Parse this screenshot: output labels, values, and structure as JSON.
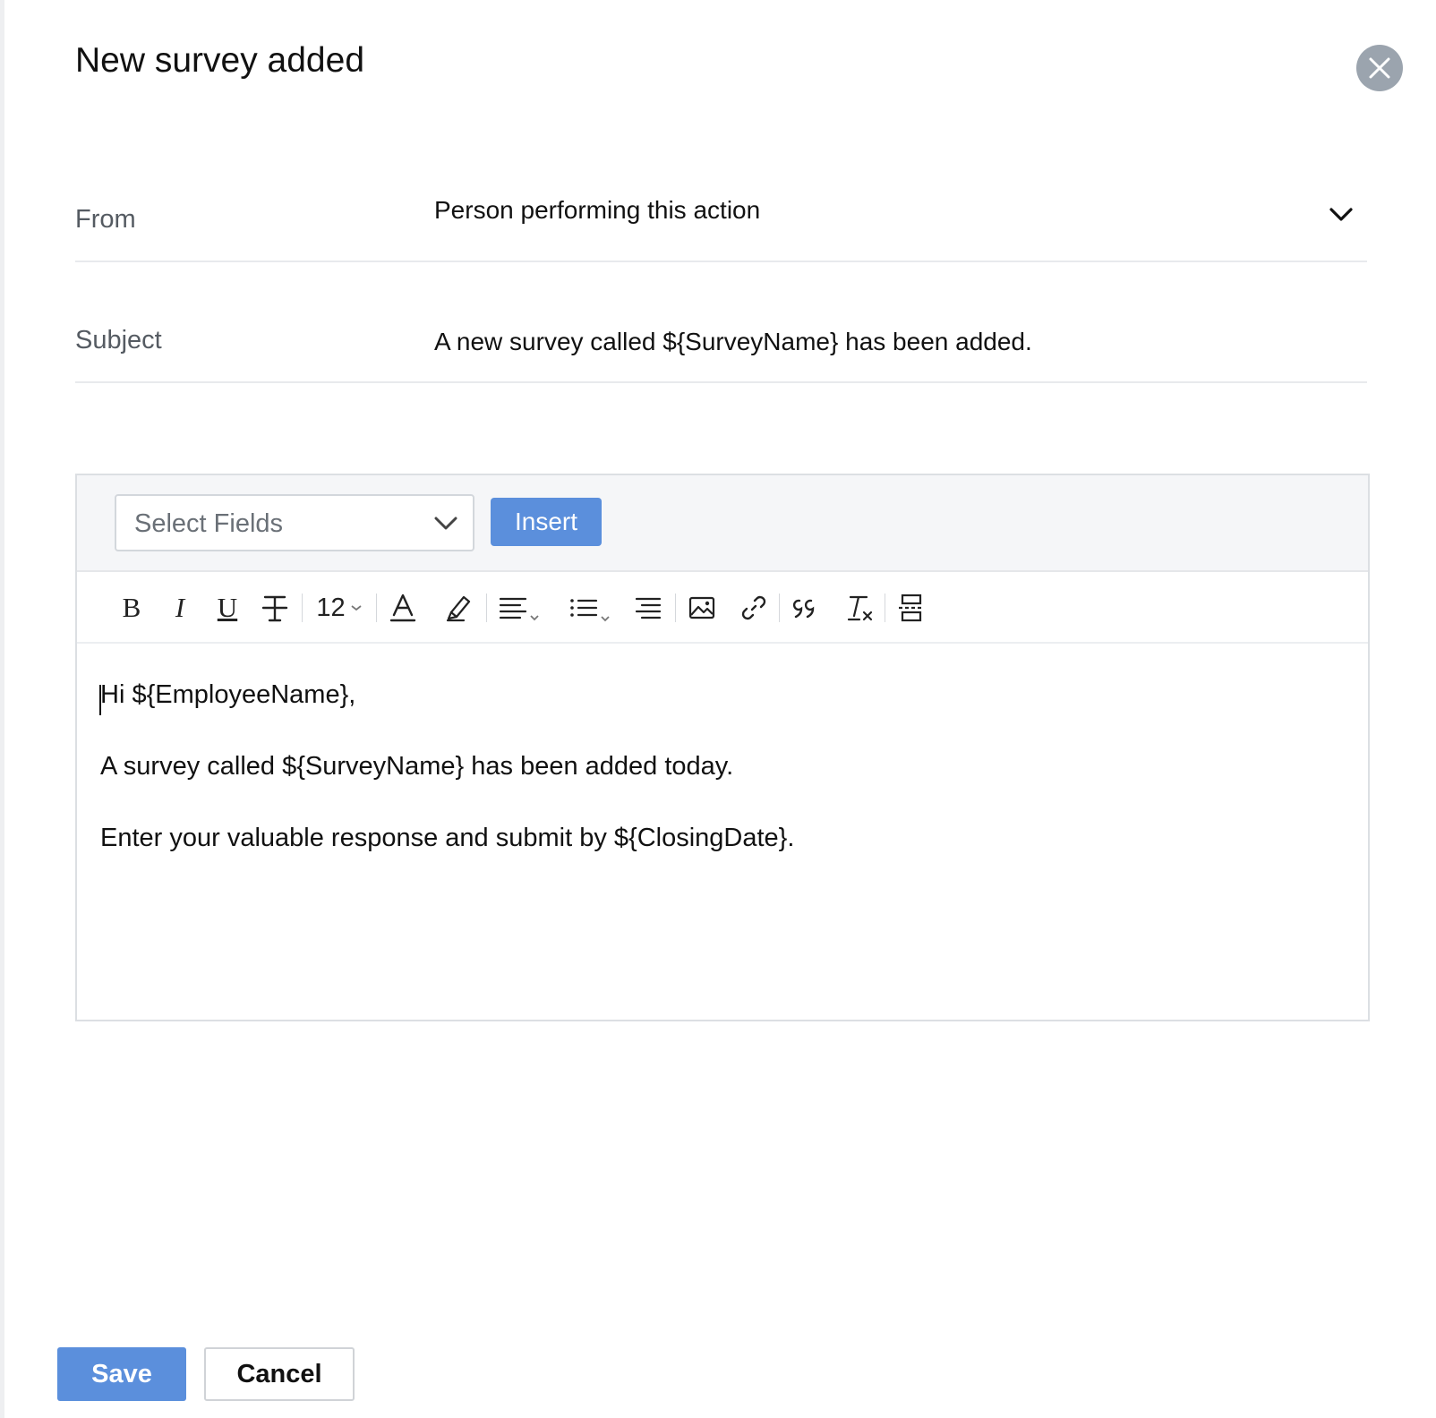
{
  "dialog": {
    "title": "New survey added"
  },
  "form": {
    "from": {
      "label": "From",
      "value": "Person performing this action"
    },
    "subject": {
      "label": "Subject",
      "value": "A new survey called ${SurveyName} has been added."
    }
  },
  "editor": {
    "select_fields_placeholder": "Select Fields",
    "insert_label": "Insert",
    "toolbar": {
      "bold": "B",
      "italic": "I",
      "underline": "U",
      "font_size": "12"
    },
    "body_lines": [
      "Hi ${EmployeeName},",
      "A survey called ${SurveyName} has been added today.",
      "Enter your valuable response and submit by ${ClosingDate}."
    ]
  },
  "actions": {
    "save_label": "Save",
    "cancel_label": "Cancel"
  },
  "colors": {
    "primary": "#5b8fdc",
    "close_button": "#9ba4ae"
  }
}
